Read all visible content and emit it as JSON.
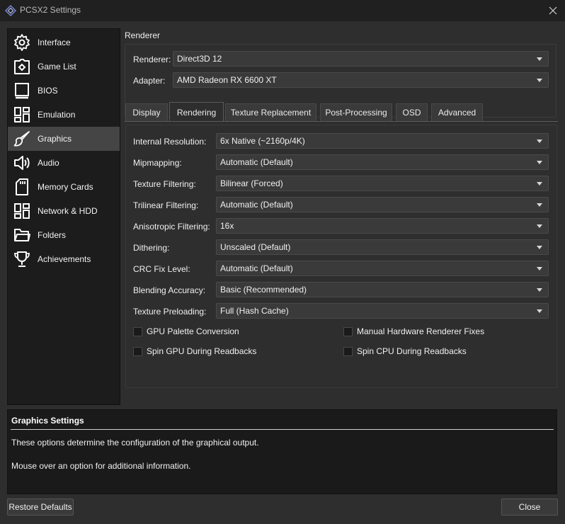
{
  "window": {
    "title": "PCSX2 Settings",
    "title_icon": "pcsx2-logo-icon",
    "close_icon": "close-icon"
  },
  "sidebar": {
    "items": [
      {
        "label": "Interface",
        "icon": "gear-icon",
        "active": false
      },
      {
        "label": "Game List",
        "icon": "game-list-icon",
        "active": false
      },
      {
        "label": "BIOS",
        "icon": "chip-icon",
        "active": false
      },
      {
        "label": "Emulation",
        "icon": "dashboard-icon",
        "active": false
      },
      {
        "label": "Graphics",
        "icon": "brush-icon",
        "active": true
      },
      {
        "label": "Audio",
        "icon": "speaker-icon",
        "active": false
      },
      {
        "label": "Memory Cards",
        "icon": "sd-card-icon",
        "active": false
      },
      {
        "label": "Network & HDD",
        "icon": "network-icon",
        "active": false
      },
      {
        "label": "Folders",
        "icon": "folder-icon",
        "active": false
      },
      {
        "label": "Achievements",
        "icon": "trophy-icon",
        "active": false
      }
    ]
  },
  "renderer_group": {
    "title": "Renderer",
    "renderer_label": "Renderer:",
    "renderer_value": "Direct3D 12",
    "adapter_label": "Adapter:",
    "adapter_value": "AMD Radeon RX 6600 XT"
  },
  "tabs": [
    {
      "label": "Display",
      "active": false
    },
    {
      "label": "Rendering",
      "active": true
    },
    {
      "label": "Texture Replacement",
      "active": false
    },
    {
      "label": "Post-Processing",
      "active": false
    },
    {
      "label": "OSD",
      "active": false
    },
    {
      "label": "Advanced",
      "active": false
    }
  ],
  "rendering": {
    "settings": [
      {
        "label": "Internal Resolution:",
        "value": "6x Native (~2160p/4K)"
      },
      {
        "label": "Mipmapping:",
        "value": "Automatic (Default)"
      },
      {
        "label": "Texture Filtering:",
        "value": "Bilinear (Forced)"
      },
      {
        "label": "Trilinear Filtering:",
        "value": "Automatic (Default)"
      },
      {
        "label": "Anisotropic Filtering:",
        "value": "16x"
      },
      {
        "label": "Dithering:",
        "value": "Unscaled (Default)"
      },
      {
        "label": "CRC Fix Level:",
        "value": "Automatic (Default)"
      },
      {
        "label": "Blending Accuracy:",
        "value": "Basic (Recommended)"
      },
      {
        "label": "Texture Preloading:",
        "value": "Full (Hash Cache)"
      }
    ],
    "checkboxes": [
      {
        "label": "GPU Palette Conversion",
        "checked": false
      },
      {
        "label": "Manual Hardware Renderer Fixes",
        "checked": false
      },
      {
        "label": "Spin GPU During Readbacks",
        "checked": false
      },
      {
        "label": "Spin CPU During Readbacks",
        "checked": false
      }
    ]
  },
  "description": {
    "title": "Graphics Settings",
    "line1": "These options determine the configuration of the graphical output.",
    "line2": "Mouse over an option for additional information."
  },
  "buttons": {
    "restore": "Restore Defaults",
    "close": "Close"
  }
}
